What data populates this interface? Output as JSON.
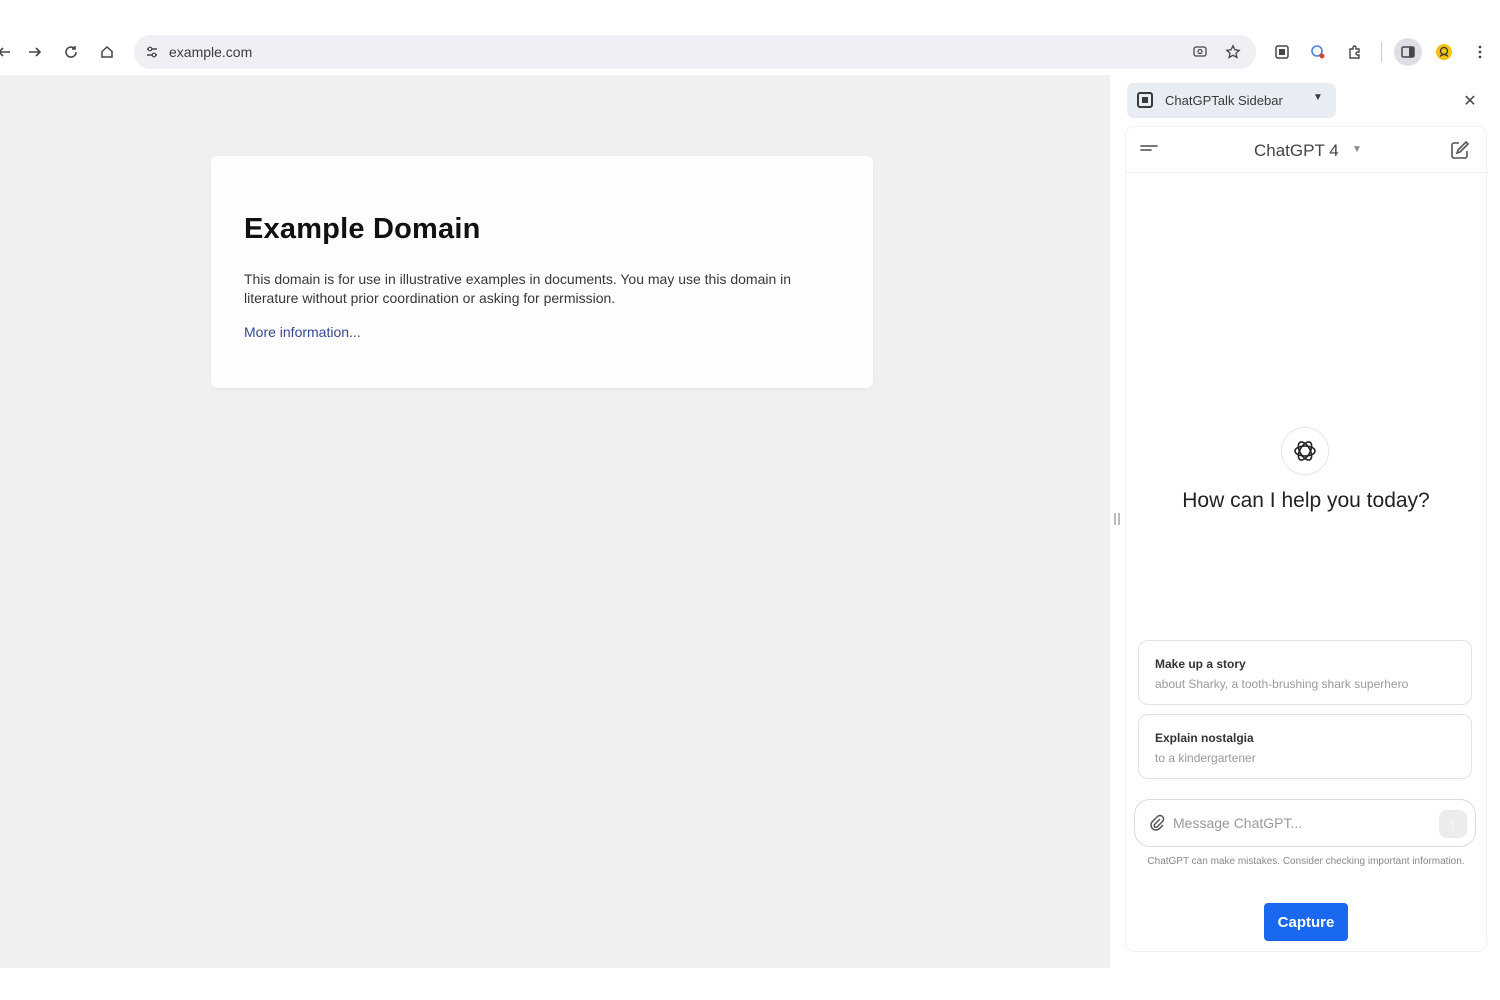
{
  "browser": {
    "url": "example.com",
    "icons": [
      "back-icon",
      "forward-icon",
      "reload-icon",
      "home-icon",
      "site-settings-icon",
      "cast-icon",
      "bookmark-star-icon",
      "extension-icon",
      "extension-icon",
      "puzzle-icon",
      "side-panel-icon",
      "profile-icon",
      "more-icon"
    ]
  },
  "page": {
    "title": "Example Domain",
    "body": "This domain is for use in illustrative examples in documents. You may use this domain in literature without prior coordination or asking for permission.",
    "link": "More information..."
  },
  "sidepanel": {
    "selector_label": "ChatGPTalk Sidebar",
    "chat": {
      "model": "ChatGPT 4",
      "greeting": "How can I help you today?",
      "suggestions": [
        {
          "title": "Make up a story",
          "subtitle": "about Sharky, a tooth-brushing shark superhero"
        },
        {
          "title": "Explain nostalgia",
          "subtitle": "to a kindergartener"
        }
      ],
      "input_placeholder": "Message ChatGPT...",
      "disclaimer": "ChatGPT can make mistakes. Consider checking important information.",
      "capture_label": "Capture"
    }
  },
  "colors": {
    "accent": "#1a68ef",
    "link": "#38488f",
    "page_bg": "#f0f0f2"
  }
}
